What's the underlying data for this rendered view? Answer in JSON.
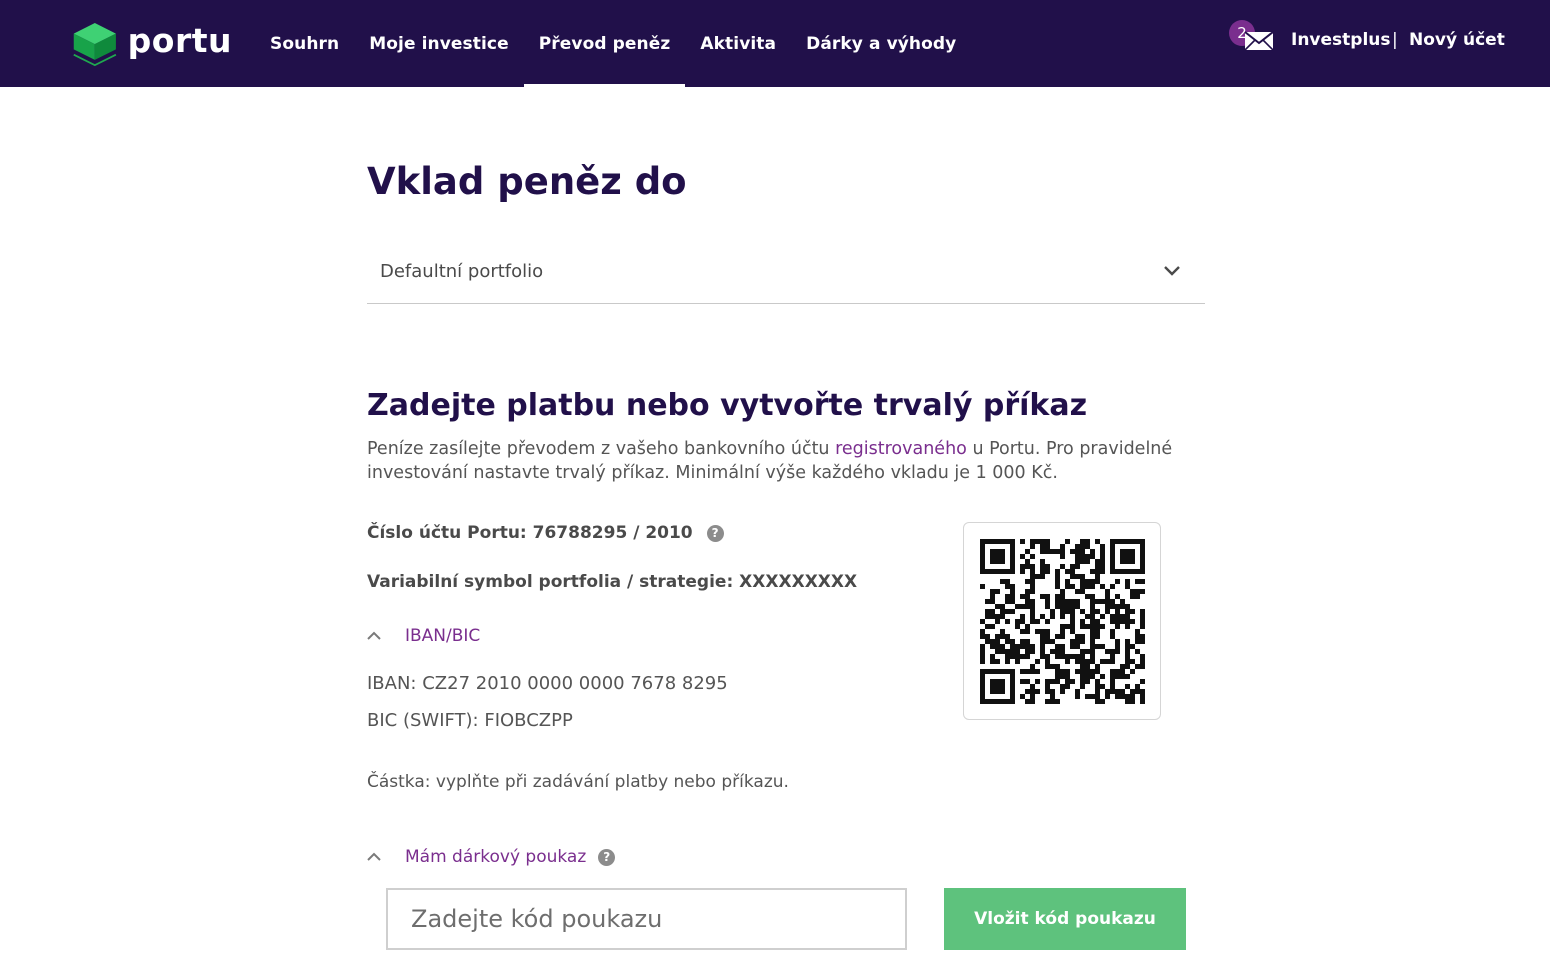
{
  "header": {
    "logo_text": "portu",
    "nav": [
      {
        "label": "Souhrn",
        "active": false
      },
      {
        "label": "Moje investice",
        "active": false
      },
      {
        "label": "Převod peněz",
        "active": true
      },
      {
        "label": "Aktivita",
        "active": false
      },
      {
        "label": "Dárky a výhody",
        "active": false
      }
    ],
    "messages": {
      "count": "2",
      "icon": "mail-icon"
    },
    "account_name": "Investplus",
    "separator": "|",
    "new_account_label": "Nový účet"
  },
  "main": {
    "title": "Vklad peněz do",
    "portfolio_select": {
      "value": "Defaultní portfolio",
      "icon": "chevron-down-icon"
    },
    "section_title": "Zadejte platbu nebo vytvořte trvalý příkaz",
    "description": {
      "before_link": "Peníze zasílejte převodem z vašeho bankovního účtu ",
      "link": "registrovaného",
      "after_link": " u Portu. Pro pravidelné investování nastavte trvalý příkaz. Minimální výše každého vkladu je 1 000 Kč."
    },
    "account_number": "Číslo účtu Portu: 76788295 / 2010",
    "variable_symbol": "Variabilní symbol portfolia / strategie: XXXXXXXXX",
    "iban_toggle": "IBAN/BIC",
    "iban": "IBAN: CZ27 2010 0000 0000 7678 8295",
    "bic": "BIC (SWIFT): FIOBCZPP",
    "amount_note": "Částka: vyplňte při zadávání platby nebo příkazu.",
    "voucher_toggle": "Mám dárkový poukaz",
    "voucher_placeholder": "Zadejte kód poukazu",
    "voucher_button": "Vložit kód poukazu",
    "help_glyph": "?"
  },
  "colors": {
    "header_bg": "#21104a",
    "accent_purple": "#7a2e8e",
    "button_green": "#5ec27d",
    "logo_green": "#1fa84f"
  }
}
